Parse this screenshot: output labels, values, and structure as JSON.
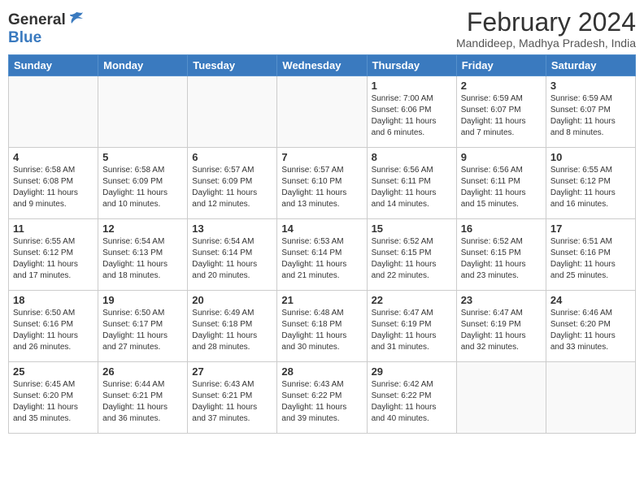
{
  "header": {
    "logo_general": "General",
    "logo_blue": "Blue",
    "month_year": "February 2024",
    "location": "Mandideep, Madhya Pradesh, India"
  },
  "days_of_week": [
    "Sunday",
    "Monday",
    "Tuesday",
    "Wednesday",
    "Thursday",
    "Friday",
    "Saturday"
  ],
  "weeks": [
    [
      {
        "day": "",
        "info": ""
      },
      {
        "day": "",
        "info": ""
      },
      {
        "day": "",
        "info": ""
      },
      {
        "day": "",
        "info": ""
      },
      {
        "day": "1",
        "info": "Sunrise: 7:00 AM\nSunset: 6:06 PM\nDaylight: 11 hours\nand 6 minutes."
      },
      {
        "day": "2",
        "info": "Sunrise: 6:59 AM\nSunset: 6:07 PM\nDaylight: 11 hours\nand 7 minutes."
      },
      {
        "day": "3",
        "info": "Sunrise: 6:59 AM\nSunset: 6:07 PM\nDaylight: 11 hours\nand 8 minutes."
      }
    ],
    [
      {
        "day": "4",
        "info": "Sunrise: 6:58 AM\nSunset: 6:08 PM\nDaylight: 11 hours\nand 9 minutes."
      },
      {
        "day": "5",
        "info": "Sunrise: 6:58 AM\nSunset: 6:09 PM\nDaylight: 11 hours\nand 10 minutes."
      },
      {
        "day": "6",
        "info": "Sunrise: 6:57 AM\nSunset: 6:09 PM\nDaylight: 11 hours\nand 12 minutes."
      },
      {
        "day": "7",
        "info": "Sunrise: 6:57 AM\nSunset: 6:10 PM\nDaylight: 11 hours\nand 13 minutes."
      },
      {
        "day": "8",
        "info": "Sunrise: 6:56 AM\nSunset: 6:11 PM\nDaylight: 11 hours\nand 14 minutes."
      },
      {
        "day": "9",
        "info": "Sunrise: 6:56 AM\nSunset: 6:11 PM\nDaylight: 11 hours\nand 15 minutes."
      },
      {
        "day": "10",
        "info": "Sunrise: 6:55 AM\nSunset: 6:12 PM\nDaylight: 11 hours\nand 16 minutes."
      }
    ],
    [
      {
        "day": "11",
        "info": "Sunrise: 6:55 AM\nSunset: 6:12 PM\nDaylight: 11 hours\nand 17 minutes."
      },
      {
        "day": "12",
        "info": "Sunrise: 6:54 AM\nSunset: 6:13 PM\nDaylight: 11 hours\nand 18 minutes."
      },
      {
        "day": "13",
        "info": "Sunrise: 6:54 AM\nSunset: 6:14 PM\nDaylight: 11 hours\nand 20 minutes."
      },
      {
        "day": "14",
        "info": "Sunrise: 6:53 AM\nSunset: 6:14 PM\nDaylight: 11 hours\nand 21 minutes."
      },
      {
        "day": "15",
        "info": "Sunrise: 6:52 AM\nSunset: 6:15 PM\nDaylight: 11 hours\nand 22 minutes."
      },
      {
        "day": "16",
        "info": "Sunrise: 6:52 AM\nSunset: 6:15 PM\nDaylight: 11 hours\nand 23 minutes."
      },
      {
        "day": "17",
        "info": "Sunrise: 6:51 AM\nSunset: 6:16 PM\nDaylight: 11 hours\nand 25 minutes."
      }
    ],
    [
      {
        "day": "18",
        "info": "Sunrise: 6:50 AM\nSunset: 6:16 PM\nDaylight: 11 hours\nand 26 minutes."
      },
      {
        "day": "19",
        "info": "Sunrise: 6:50 AM\nSunset: 6:17 PM\nDaylight: 11 hours\nand 27 minutes."
      },
      {
        "day": "20",
        "info": "Sunrise: 6:49 AM\nSunset: 6:18 PM\nDaylight: 11 hours\nand 28 minutes."
      },
      {
        "day": "21",
        "info": "Sunrise: 6:48 AM\nSunset: 6:18 PM\nDaylight: 11 hours\nand 30 minutes."
      },
      {
        "day": "22",
        "info": "Sunrise: 6:47 AM\nSunset: 6:19 PM\nDaylight: 11 hours\nand 31 minutes."
      },
      {
        "day": "23",
        "info": "Sunrise: 6:47 AM\nSunset: 6:19 PM\nDaylight: 11 hours\nand 32 minutes."
      },
      {
        "day": "24",
        "info": "Sunrise: 6:46 AM\nSunset: 6:20 PM\nDaylight: 11 hours\nand 33 minutes."
      }
    ],
    [
      {
        "day": "25",
        "info": "Sunrise: 6:45 AM\nSunset: 6:20 PM\nDaylight: 11 hours\nand 35 minutes."
      },
      {
        "day": "26",
        "info": "Sunrise: 6:44 AM\nSunset: 6:21 PM\nDaylight: 11 hours\nand 36 minutes."
      },
      {
        "day": "27",
        "info": "Sunrise: 6:43 AM\nSunset: 6:21 PM\nDaylight: 11 hours\nand 37 minutes."
      },
      {
        "day": "28",
        "info": "Sunrise: 6:43 AM\nSunset: 6:22 PM\nDaylight: 11 hours\nand 39 minutes."
      },
      {
        "day": "29",
        "info": "Sunrise: 6:42 AM\nSunset: 6:22 PM\nDaylight: 11 hours\nand 40 minutes."
      },
      {
        "day": "",
        "info": ""
      },
      {
        "day": "",
        "info": ""
      }
    ]
  ]
}
